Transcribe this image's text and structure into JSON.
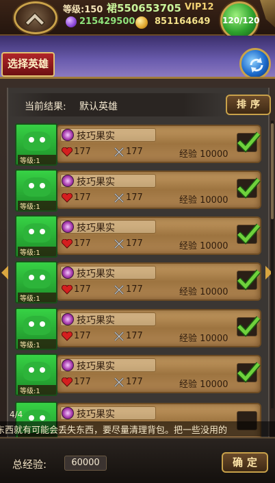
{
  "header": {
    "level": "等级:150",
    "qq": "裙550653705",
    "vip": "VIP12",
    "gems": "215429500",
    "coins": "851164649",
    "energy": "120/120"
  },
  "select_hero_label": "选择英雄",
  "result": {
    "label": "当前结果:",
    "value": "默认英雄",
    "sort_label": "排序"
  },
  "cards": [
    {
      "item": "技巧果实",
      "hp": "177",
      "atk": "177",
      "exp": "经验 10000",
      "level": "等级:1",
      "checked": true
    },
    {
      "item": "技巧果实",
      "hp": "177",
      "atk": "177",
      "exp": "经验 10000",
      "level": "等级:1",
      "checked": true
    },
    {
      "item": "技巧果实",
      "hp": "177",
      "atk": "177",
      "exp": "经验 10000",
      "level": "等级:1",
      "checked": true
    },
    {
      "item": "技巧果实",
      "hp": "177",
      "atk": "177",
      "exp": "经验 10000",
      "level": "等级:1",
      "checked": true
    },
    {
      "item": "技巧果实",
      "hp": "177",
      "atk": "177",
      "exp": "经验 10000",
      "level": "等级:1",
      "checked": true
    },
    {
      "item": "技巧果实",
      "hp": "177",
      "atk": "177",
      "exp": "经验 10000",
      "level": "等级:1",
      "checked": true
    },
    {
      "item": "技巧果实",
      "hp": "",
      "atk": "",
      "exp": "",
      "level": "",
      "checked": false
    }
  ],
  "page_indicator": "4/4",
  "marquee": "东西就有可能会丢失东西，要尽量清理背包。把一些没用的",
  "footer": {
    "total_label": "总经验:",
    "total_value": "60000",
    "confirm_label": "确定"
  },
  "colors": {
    "accent_gold": "#c9a24a",
    "check_green": "#6fd13c",
    "card_wood": "#b08552"
  }
}
